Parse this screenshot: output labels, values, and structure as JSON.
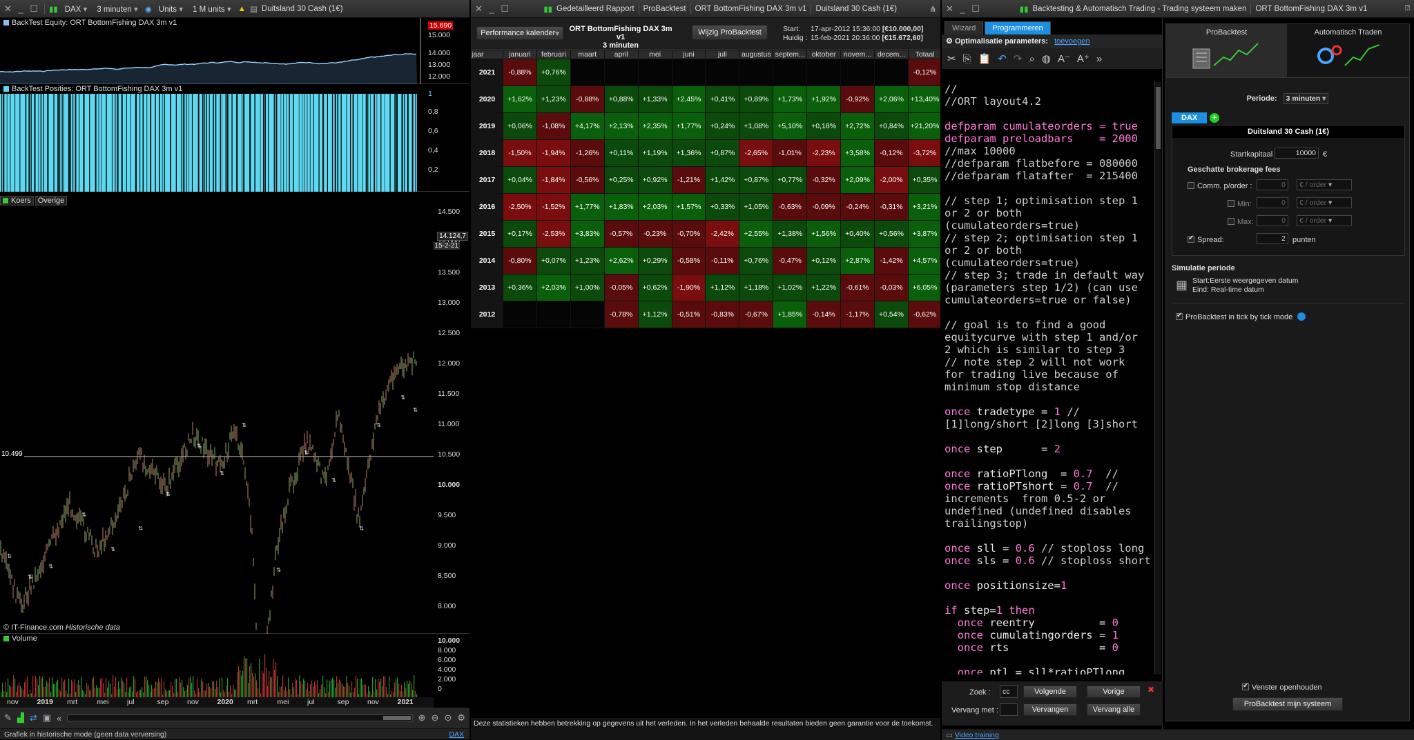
{
  "chart_window": {
    "toolbar": {
      "instrument": "DAX",
      "timeframe": "3 minuten",
      "units_mode": "Units",
      "units_size": "1 M units",
      "product": "Duitsland 30 Cash (1€)"
    },
    "equity_label": "BackTest Equity: ORT  BottomFishing DAX 3m v1",
    "equity_axis": [
      "15.690",
      "15.000",
      "14.000",
      "13.000",
      "12.000"
    ],
    "positions_label": "BackTest Posities: ORT  BottomFishing DAX 3m v1",
    "positions_axis": [
      "1",
      "0,8",
      "0,6",
      "0,4",
      "0,2"
    ],
    "price_tabs": [
      "Koers",
      "Overige"
    ],
    "price_axis": [
      "14.500",
      "14.000",
      "13.500",
      "13.000",
      "12.500",
      "12.000",
      "11.500",
      "11.000",
      "10.500",
      "10.000",
      "9.500",
      "9.000",
      "8.500",
      "8.000"
    ],
    "price_last": "14.124,7",
    "price_last_date": "15-2-21",
    "hline_value": "10.499",
    "source_label": "© IT-Finance.com",
    "source_sub": "Historische data",
    "volume_label": "Volume",
    "volume_axis": [
      "10.000",
      "8.000",
      "6.000",
      "4.000",
      "2.000",
      "0"
    ],
    "x_labels": [
      "nov",
      "2019",
      "mrt",
      "mei",
      "jul",
      "sep",
      "nov",
      "2020",
      "mrt",
      "mei",
      "jul",
      "sep",
      "nov",
      "2021"
    ],
    "status": "Grafiek in historische mode (geen data verversing)",
    "status_right": "DAX"
  },
  "report_window": {
    "titlebar": [
      "Gedetailleerd Rapport",
      "ProBacktest",
      "ORT  BottomFishing DAX 3m v1",
      "Duitsland 30 Cash (1€)"
    ],
    "view_select": "Performance kalender",
    "system_name": "ORT  BottomFishing DAX 3m v1",
    "system_tf": "3 minuten",
    "edit_button": "Wijzig ProBacktest",
    "start_label": "Start:",
    "start_value": "17-apr-2012 15:36:00",
    "start_capital": "[€10.000,00]",
    "now_label": "Huidig :",
    "now_value": "15-feb-2021 20:36:00",
    "now_capital": "[€15.672,60]",
    "columns": [
      "jaar",
      "januari",
      "februari",
      "maart",
      "april",
      "mei",
      "juni",
      "juli",
      "augustus",
      "septem...",
      "oktober",
      "novem...",
      "decem...",
      "Totaal"
    ],
    "rows": [
      [
        "2021",
        "-0,88%",
        "+0,76%",
        "",
        "",
        "",
        "",
        "",
        "",
        "",
        "",
        "",
        "",
        "-0,12%"
      ],
      [
        "2020",
        "+1,62%",
        "+1,23%",
        "-0,88%",
        "+0,88%",
        "+1,33%",
        "+2,45%",
        "+0,41%",
        "+0,89%",
        "+1,73%",
        "+1,92%",
        "-0,92%",
        "+2,06%",
        "+13,40%"
      ],
      [
        "2019",
        "+0,06%",
        "-1,08%",
        "+4,17%",
        "+2,13%",
        "+2,35%",
        "+1,77%",
        "+0,24%",
        "+1,08%",
        "+5,10%",
        "+0,18%",
        "+2,72%",
        "+0,84%",
        "+21,20%"
      ],
      [
        "2018",
        "-1,50%",
        "-1,94%",
        "-1,26%",
        "+0,11%",
        "+1,19%",
        "+1,36%",
        "+0,87%",
        "-2,65%",
        "-1,01%",
        "-2,23%",
        "+3,58%",
        "-0,12%",
        "-3,72%"
      ],
      [
        "2017",
        "+0,04%",
        "-1,84%",
        "-0,56%",
        "+0,25%",
        "+0,92%",
        "-1,21%",
        "+1,42%",
        "+0,87%",
        "+0,77%",
        "-0,32%",
        "+2,09%",
        "-2,00%",
        "+0,35%"
      ],
      [
        "2016",
        "-2,50%",
        "-1,52%",
        "+1,77%",
        "+1,83%",
        "+2,03%",
        "+1,57%",
        "+0,33%",
        "+1,05%",
        "-0,63%",
        "-0,09%",
        "-0,24%",
        "-0,31%",
        "+3,21%"
      ],
      [
        "2015",
        "+0,17%",
        "-2,53%",
        "+3,83%",
        "-0,57%",
        "-0,23%",
        "-0,70%",
        "-2,42%",
        "+2,55%",
        "+1,38%",
        "+1,56%",
        "+0,40%",
        "+0,56%",
        "+3,87%"
      ],
      [
        "2014",
        "-0,80%",
        "+0,07%",
        "+1,23%",
        "+2,62%",
        "+0,29%",
        "-0,58%",
        "-0,11%",
        "+0,76%",
        "-0,47%",
        "+0,12%",
        "+2,87%",
        "-1,42%",
        "+4,57%"
      ],
      [
        "2013",
        "+0,36%",
        "+2,03%",
        "+1,00%",
        "-0,05%",
        "+0,62%",
        "-1,90%",
        "+1,12%",
        "+1,18%",
        "+1,02%",
        "+1,22%",
        "-0,61%",
        "-0,03%",
        "+6,05%"
      ],
      [
        "2012",
        "",
        "",
        "",
        "-0,78%",
        "+1,12%",
        "-0,51%",
        "-0,83%",
        "-0,67%",
        "+1,85%",
        "-0,14%",
        "-1,17%",
        "+0,54%",
        "-0,62%"
      ]
    ],
    "disclaimer": "Deze statistieken hebben betrekking op gegevens uit het verleden. In het verleden behaalde resultaten bieden geen garantie voor de toekomst."
  },
  "trading_window": {
    "title": "Backtesting & Automatisch Trading - Trading systeem maken",
    "title_system": "ORT  BottomFishing DAX 3m v1",
    "tabs": [
      "Wizard",
      "Programmeren"
    ],
    "opt_label": "Optimalisatie parameters:",
    "opt_link": "toevoegen",
    "code": [
      [
        [
          "cm",
          "//"
        ]
      ],
      [
        [
          "cm",
          "//ORT layout4.2"
        ]
      ],
      [
        [
          "",
          ""
        ]
      ],
      [
        [
          "kw",
          "defparam cumulateorders = true"
        ]
      ],
      [
        [
          "kw",
          "defparam preloadbars    = 2000"
        ]
      ],
      [
        [
          "cm",
          "//max 10000"
        ]
      ],
      [
        [
          "cm",
          "//defparam flatbefore = 080000"
        ]
      ],
      [
        [
          "cm",
          "//defparam flatafter  = 215400"
        ]
      ],
      [
        [
          "",
          ""
        ]
      ],
      [
        [
          "cm",
          "// step 1; optimisation step 1"
        ]
      ],
      [
        [
          "cm",
          "or 2 or both"
        ]
      ],
      [
        [
          "cm",
          "(cumulateorders=true)"
        ]
      ],
      [
        [
          "cm",
          "// step 2; optimisation step 1"
        ]
      ],
      [
        [
          "cm",
          "or 2 or both"
        ]
      ],
      [
        [
          "cm",
          "(cumulateorders=true)"
        ]
      ],
      [
        [
          "cm",
          "// step 3; trade in default way"
        ]
      ],
      [
        [
          "cm",
          "(parameters step 1/2) (can use"
        ]
      ],
      [
        [
          "cm",
          "cumulateorders=true or false)"
        ]
      ],
      [
        [
          "",
          ""
        ]
      ],
      [
        [
          "cm",
          "// goal is to find a good"
        ]
      ],
      [
        [
          "cm",
          "equitycurve with step 1 and/or"
        ]
      ],
      [
        [
          "cm",
          "2 which is similar to step 3"
        ]
      ],
      [
        [
          "cm",
          "// note step 2 will not work"
        ]
      ],
      [
        [
          "cm",
          "for trading live because of"
        ]
      ],
      [
        [
          "cm",
          "minimum stop distance"
        ]
      ],
      [
        [
          "",
          ""
        ]
      ],
      [
        [
          "kw",
          "once"
        ],
        [
          "",
          " tradetype = "
        ],
        [
          "kw",
          "1"
        ],
        [
          "cm",
          " //"
        ]
      ],
      [
        [
          "cm",
          "[1]long/short [2]long [3]short"
        ]
      ],
      [
        [
          "",
          ""
        ]
      ],
      [
        [
          "kw",
          "once"
        ],
        [
          "",
          " step      = "
        ],
        [
          "kw",
          "2"
        ]
      ],
      [
        [
          "",
          ""
        ]
      ],
      [
        [
          "kw",
          "once"
        ],
        [
          "",
          " ratioPTlong  = "
        ],
        [
          "kw",
          "0.7"
        ],
        [
          "cm",
          "  //"
        ]
      ],
      [
        [
          "kw",
          "once"
        ],
        [
          "",
          " ratioPTshort = "
        ],
        [
          "kw",
          "0.7"
        ],
        [
          "cm",
          "  //"
        ]
      ],
      [
        [
          "cm",
          "increments  from 0.5-2 or"
        ]
      ],
      [
        [
          "cm",
          "undefined (undefined disables"
        ]
      ],
      [
        [
          "cm",
          "trailingstop)"
        ]
      ],
      [
        [
          "",
          ""
        ]
      ],
      [
        [
          "kw",
          "once"
        ],
        [
          "",
          " sll = "
        ],
        [
          "kw",
          "0.6"
        ],
        [
          "cm",
          " // stoploss long"
        ]
      ],
      [
        [
          "kw",
          "once"
        ],
        [
          "",
          " sls = "
        ],
        [
          "kw",
          "0.6"
        ],
        [
          "cm",
          " // stoploss short"
        ]
      ],
      [
        [
          "",
          ""
        ]
      ],
      [
        [
          "kw",
          "once"
        ],
        [
          "",
          " positionsize="
        ],
        [
          "kw",
          "1"
        ]
      ],
      [
        [
          "",
          ""
        ]
      ],
      [
        [
          "kw",
          "if"
        ],
        [
          "",
          " step="
        ],
        [
          "kw",
          "1"
        ],
        [
          "kw",
          " then"
        ]
      ],
      [
        [
          "",
          "  "
        ],
        [
          "kw",
          "once"
        ],
        [
          "",
          " reentry          = "
        ],
        [
          "kw",
          "0"
        ]
      ],
      [
        [
          "",
          "  "
        ],
        [
          "kw",
          "once"
        ],
        [
          "",
          " cumulatingorders = "
        ],
        [
          "kw",
          "1"
        ]
      ],
      [
        [
          "",
          "  "
        ],
        [
          "kw",
          "once"
        ],
        [
          "",
          " rts              = "
        ],
        [
          "kw",
          "0"
        ]
      ],
      [
        [
          "",
          ""
        ]
      ],
      [
        [
          "",
          "  "
        ],
        [
          "kw",
          "once"
        ],
        [
          "",
          " ptl = sll*ratioPTlong"
        ]
      ]
    ],
    "search_label": "Zoek :",
    "search_value": "cc",
    "next_btn": "Volgende",
    "prev_btn": "Vorige",
    "replace_label": "Vervang met :",
    "replace_btn": "Vervangen",
    "replace_all_btn": "Vervang alle",
    "video_link": "Video training",
    "modes": [
      "ProBacktest",
      "Automatisch Traden"
    ],
    "period_label": "Periode:",
    "period_value": "3 minuten",
    "instrument_tab": "DAX",
    "instrument_name": "Duitsland 30 Cash (1€)",
    "capital_label": "Startkapitaal :",
    "capital_value": "10000",
    "currency": "€",
    "fees_header": "Geschatte brokerage fees",
    "comm_label": "Comm. p/order :",
    "min_label": "Min:",
    "max_label": "Max:",
    "fee_value": "0",
    "fee_unit": "€ / order",
    "spread_label": "Spread:",
    "spread_value": "2",
    "spread_unit": "punten",
    "sim_header": "Simulatie periode",
    "sim_start": "Start:Eerste weergegeven datum",
    "sim_end": "Eind: Real-time datum",
    "tick_label": "ProBacktest in tick by tick mode",
    "keep_open": "Venster openhouden",
    "run_button": "ProBacktest mijn systeem"
  }
}
